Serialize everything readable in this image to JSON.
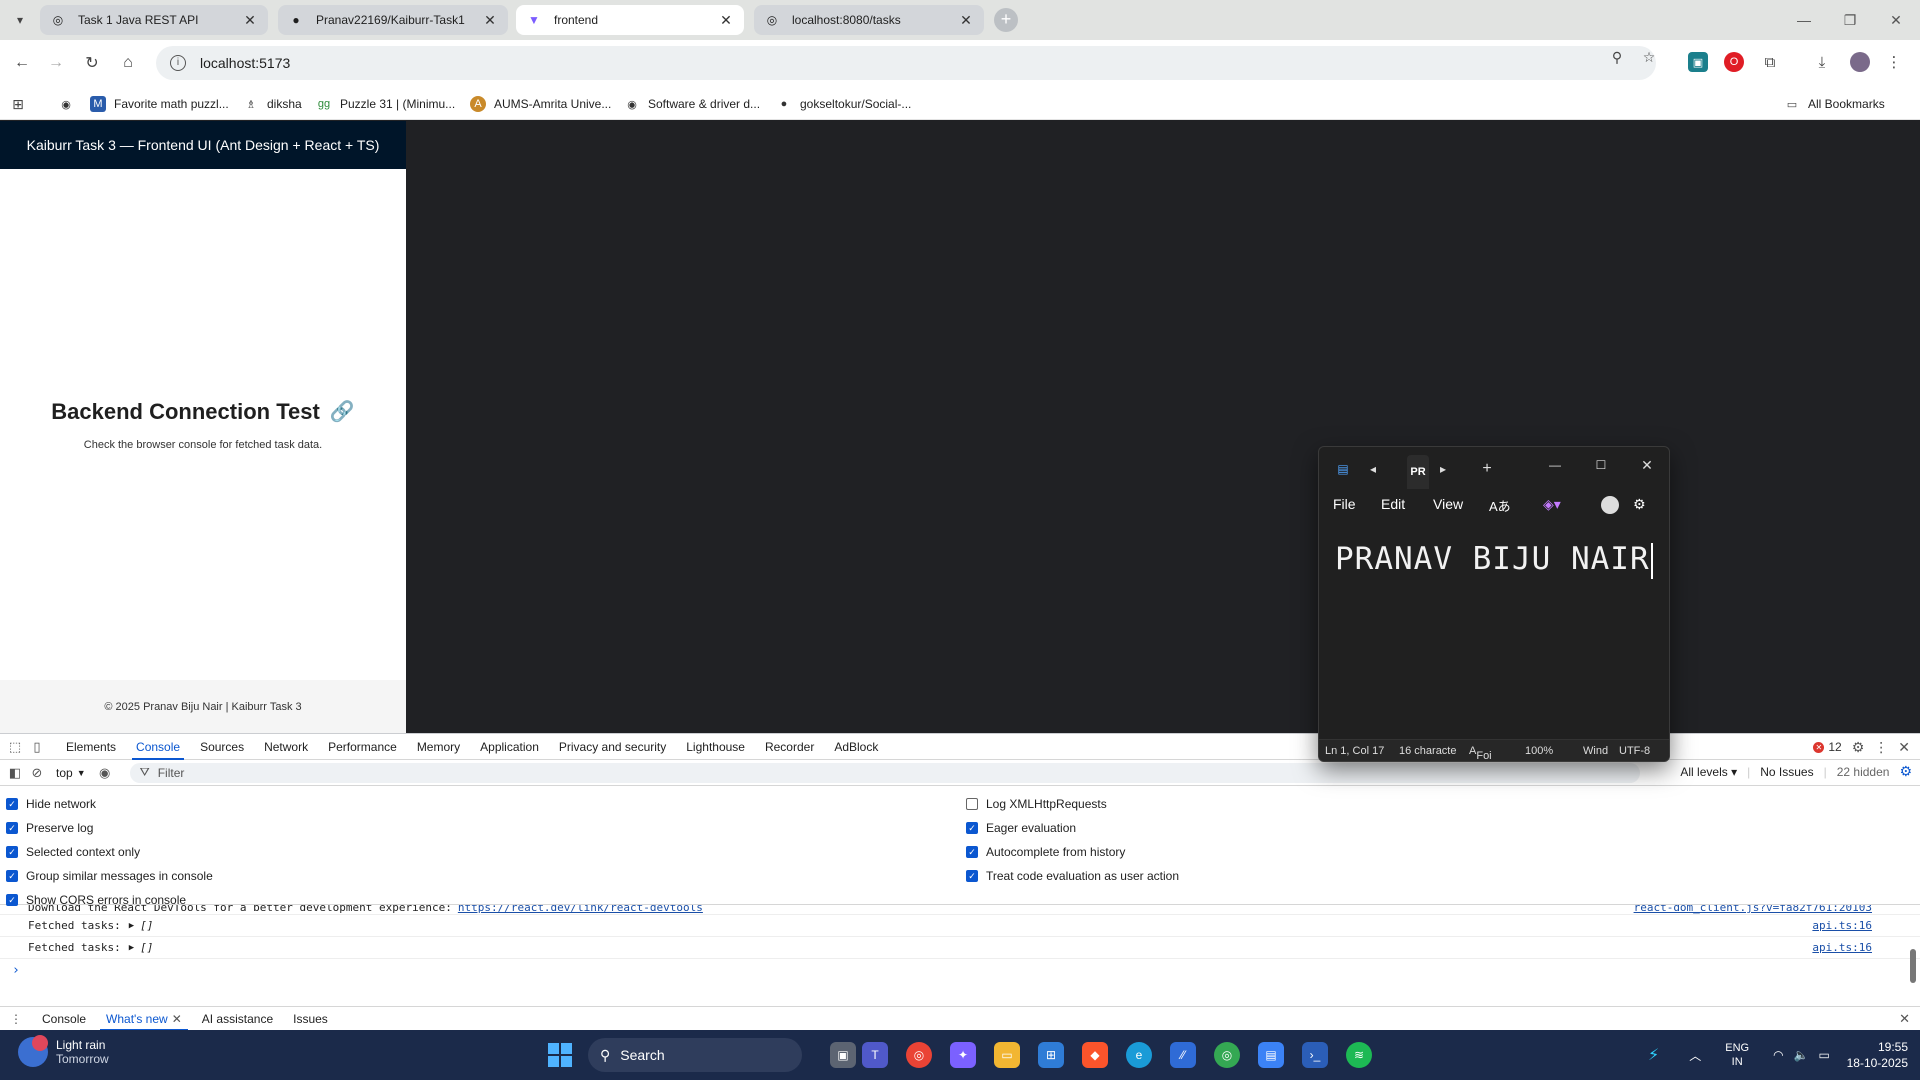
{
  "browser": {
    "tabs": [
      {
        "title": "Task 1 Java REST API",
        "active": false
      },
      {
        "title": "Pranav22169/Kaiburr-Task1",
        "active": false
      },
      {
        "title": "frontend",
        "active": true
      },
      {
        "title": "localhost:8080/tasks",
        "active": false
      }
    ],
    "new_tab": "+",
    "url": "localhost:5173",
    "bookmarks": [
      "Favorite math puzzl...",
      "diksha",
      "Puzzle 31 | (Minimu...",
      "AUMS-Amrita Unive...",
      "Software & driver d...",
      "gokseltokur/Social-..."
    ],
    "all_bookmarks": "All Bookmarks"
  },
  "page": {
    "header": "Kaiburr Task 3 — Frontend UI (Ant Design + React + TS)",
    "heading": "Backend Connection Test",
    "heading_icon": "🔗",
    "description": "Check the browser console for fetched task data.",
    "footer": "© 2025 Pranav Biju Nair | Kaiburr Task 3"
  },
  "devtools": {
    "tabs": [
      "Elements",
      "Console",
      "Sources",
      "Network",
      "Performance",
      "Memory",
      "Application",
      "Privacy and security",
      "Lighthouse",
      "Recorder",
      "AdBlock"
    ],
    "active_tab": "Console",
    "error_count": "12",
    "context": "top",
    "filter_placeholder": "Filter",
    "levels": "All levels",
    "issues": "No Issues",
    "hidden": "22 hidden",
    "settings_left": [
      {
        "label": "Hide network",
        "checked": true
      },
      {
        "label": "Preserve log",
        "checked": true
      },
      {
        "label": "Selected context only",
        "checked": true
      },
      {
        "label": "Group similar messages in console",
        "checked": true
      },
      {
        "label": "Show CORS errors in console",
        "checked": true
      }
    ],
    "settings_right": [
      {
        "label": "Log XMLHttpRequests",
        "checked": false
      },
      {
        "label": "Eager evaluation",
        "checked": true
      },
      {
        "label": "Autocomplete from history",
        "checked": true
      },
      {
        "label": "Treat code evaluation as user action",
        "checked": true
      }
    ],
    "console_lines": [
      {
        "text": "Download the React DevTools for a better development experience:",
        "link": "https://react.dev/link/react-devtools",
        "source": "react-dom_client.js?v=fa82f761:20103"
      },
      {
        "text": "Fetched tasks:",
        "value": "[]",
        "source": "api.ts:16"
      },
      {
        "text": "Fetched tasks:",
        "value": "[]",
        "source": "api.ts:16"
      }
    ],
    "prompt": "›",
    "drawer_tabs": [
      "Console",
      "What's new",
      "AI assistance",
      "Issues"
    ],
    "drawer_active": "What's new"
  },
  "notepad": {
    "tab_title": "PR",
    "menu": [
      "File",
      "Edit",
      "View"
    ],
    "content": "PRANAV BIJU NAIR",
    "status": {
      "position": "Ln 1, Col 17",
      "chars": "16 characte",
      "font": "Foi",
      "zoom": "100%",
      "line_ending": "Wind",
      "encoding": "UTF-8"
    }
  },
  "taskbar": {
    "weather_title": "Light rain",
    "weather_sub": "Tomorrow",
    "search": "Search",
    "lang1": "ENG",
    "lang2": "IN",
    "time": "19:55",
    "date": "18-10-2025"
  },
  "colors": {
    "antd_header": "#001529",
    "devtools_accent": "#0b57d0",
    "taskbar": "#1b2a4a",
    "notepad_bg": "#202020"
  }
}
